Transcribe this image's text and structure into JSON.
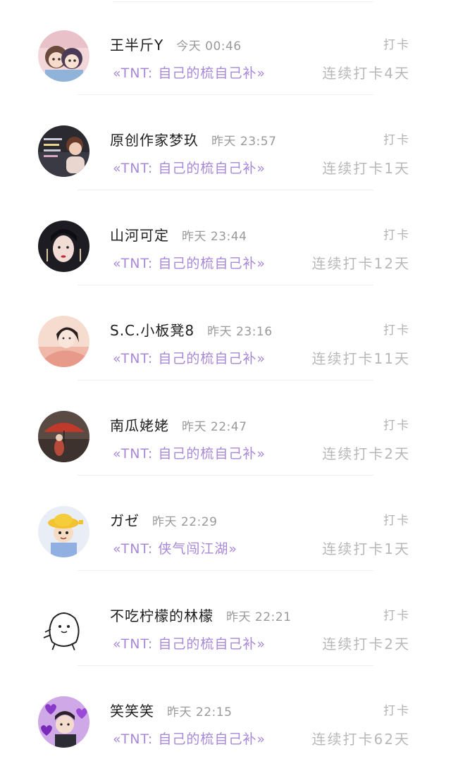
{
  "colors": {
    "name": "#1e1e1e",
    "time": "#9a9a9a",
    "topic": "#a888d8",
    "streak": "#b8b8b8",
    "action": "#b4b4b4",
    "divider": "#efeff1"
  },
  "feed": {
    "items": [
      {
        "name": "王半斤Y",
        "time": "今天 00:46",
        "action": "打卡",
        "topic": "«TNT: 自己的梳自己补»",
        "streak": "连续打卡4天",
        "avatar": "avatar-cartoon-pair-icon"
      },
      {
        "name": "原创作家梦玖",
        "time": "昨天 23:57",
        "action": "打卡",
        "topic": "«TNT: 自己的梳自己补»",
        "streak": "连续打卡1天",
        "avatar": "avatar-child-photo-icon"
      },
      {
        "name": "山河可定",
        "time": "昨天 23:44",
        "action": "打卡",
        "topic": "«TNT: 自己的梳自己补»",
        "streak": "连续打卡12天",
        "avatar": "avatar-ancient-portrait-icon"
      },
      {
        "name": "S.C.小板凳8",
        "time": "昨天 23:16",
        "action": "打卡",
        "topic": "«TNT: 自己的梳自己补»",
        "streak": "连续打卡11天",
        "avatar": "avatar-painted-lady-icon"
      },
      {
        "name": "南瓜姥姥",
        "time": "昨天 22:47",
        "action": "打卡",
        "topic": "«TNT: 自己的梳自己补»",
        "streak": "连续打卡2天",
        "avatar": "avatar-red-umbrella-icon"
      },
      {
        "name": "ガゼ",
        "time": "昨天 22:29",
        "action": "打卡",
        "topic": "«TNT: 侠气闯江湖»",
        "streak": "连续打卡1天",
        "avatar": "avatar-yellow-hat-boy-icon"
      },
      {
        "name": "不吃柠檬的林檬",
        "time": "昨天 22:21",
        "action": "打卡",
        "topic": "«TNT: 自己的梳自己补»",
        "streak": "连续打卡2天",
        "avatar": "avatar-doodle-cat-icon"
      },
      {
        "name": "笑笑笑",
        "time": "昨天 22:15",
        "action": "打卡",
        "topic": "«TNT: 自己的梳自己补»",
        "streak": "连续打卡62天",
        "avatar": "avatar-purple-hearts-icon"
      }
    ]
  }
}
